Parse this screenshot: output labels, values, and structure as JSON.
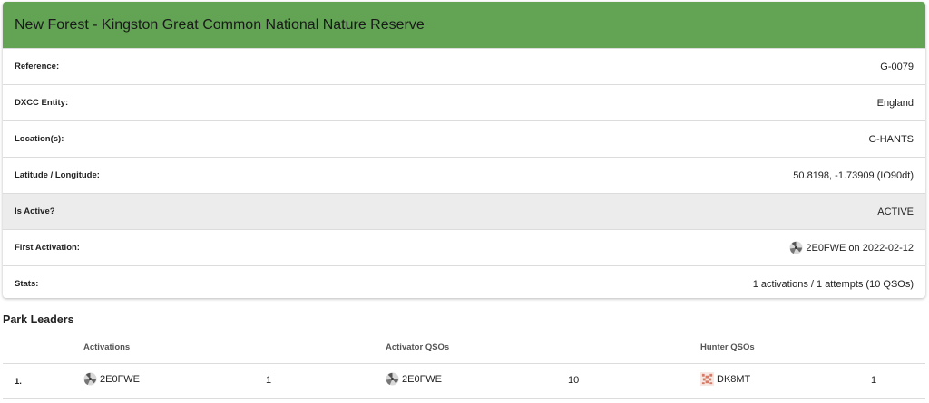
{
  "park": {
    "title": "New Forest - Kingston Great Common National Nature Reserve",
    "header_color": "#62a354",
    "details": [
      {
        "label": "Reference:",
        "value": "G-0079"
      },
      {
        "label": "DXCC Entity:",
        "value": "England"
      },
      {
        "label": "Location(s):",
        "value": "G-HANTS"
      },
      {
        "label": "Latitude / Longitude:",
        "value": "50.8198, -1.73909 (IO90dt)"
      },
      {
        "label": "Is Active?",
        "value": "ACTIVE"
      },
      {
        "label": "First Activation:",
        "value": "2E0FWE on 2022-02-12",
        "icon": "user-avatar-icon"
      },
      {
        "label": "Stats:",
        "value": "1 activations / 1 attempts (10 QSOs)"
      }
    ]
  },
  "leaders": {
    "title": "Park Leaders",
    "columns": [
      "Activations",
      "Activator QSOs",
      "Hunter QSOs"
    ],
    "rows": [
      {
        "rank": "1.",
        "activations_call": "2E0FWE",
        "activations_count": "1",
        "activator_qsos_call": "2E0FWE",
        "activator_qsos_count": "10",
        "hunter_qsos_call": "DK8MT",
        "hunter_qsos_count": "1"
      }
    ]
  }
}
